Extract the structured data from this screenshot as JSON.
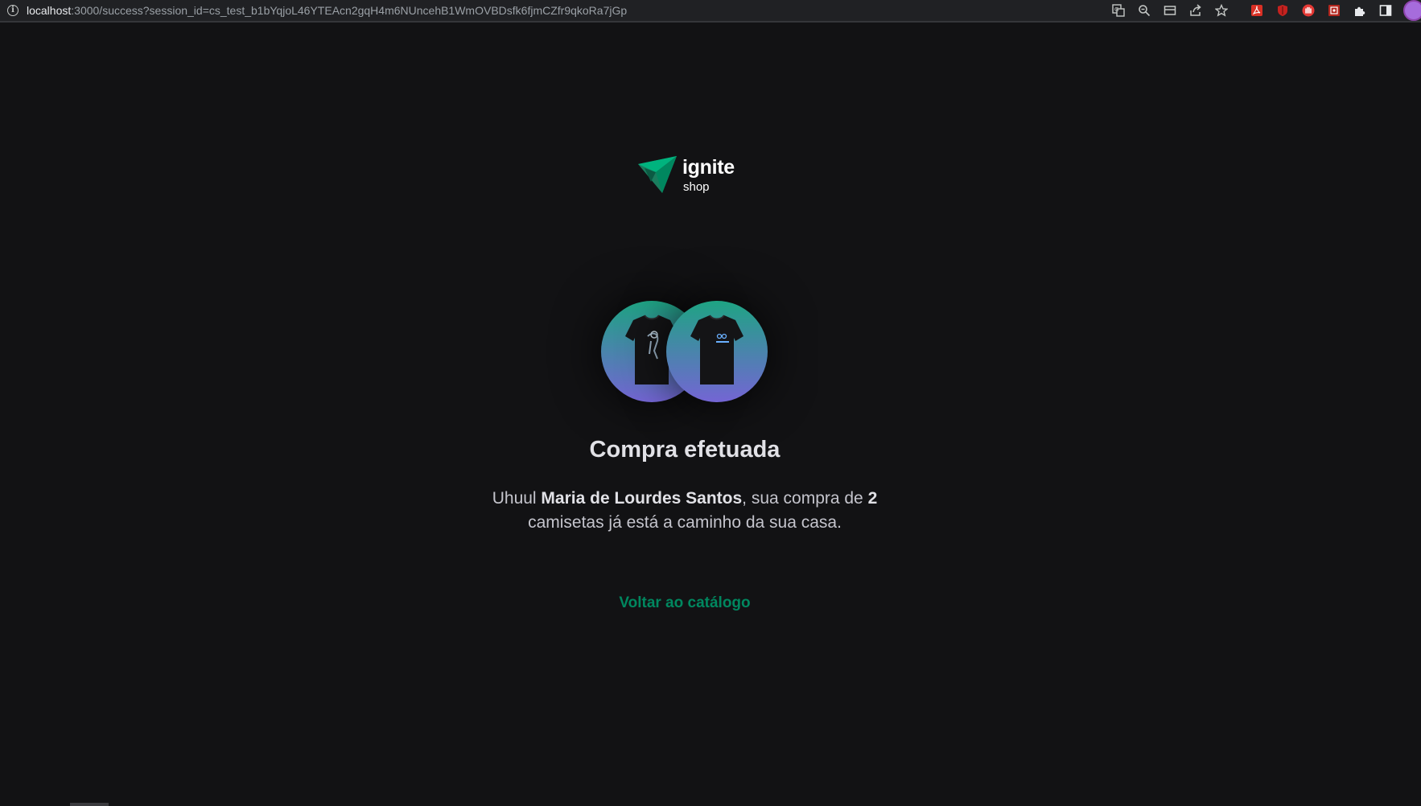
{
  "browser": {
    "url_host": "localhost",
    "url_rest": ":3000/success?session_id=cs_test_b1bYqjoL46YTEAcn2gqH4m6NUncehB1WmOVBDsfk6fjmCZfr9qkoRa7jGp",
    "toolbar_icons": [
      "translate-icon",
      "zoom-icon",
      "tab-search-icon",
      "share-icon",
      "bookmark-star-icon",
      "pdf-extension-icon",
      "shield-extension-icon",
      "hand-extension-icon",
      "puzzle-extension-icon",
      "extensions-icon",
      "side-panel-icon",
      "profile-avatar"
    ]
  },
  "logo": {
    "name": "ignite",
    "sub": "shop"
  },
  "products": [
    {
      "icon": "tshirt-image-1"
    },
    {
      "icon": "tshirt-image-2"
    }
  ],
  "success": {
    "title": "Compra efetuada",
    "msg_prefix": "Uhuul ",
    "customer_name": "Maria de Lourdes Santos",
    "msg_middle": ", sua compra de ",
    "quantity": "2",
    "msg_suffix": " camisetas já está a caminho da sua casa."
  },
  "back_link": "Voltar ao catálogo",
  "colors": {
    "background": "#121214",
    "accent": "#00875f",
    "gradient_start": "#1ea483",
    "gradient_end": "#7465d4"
  }
}
